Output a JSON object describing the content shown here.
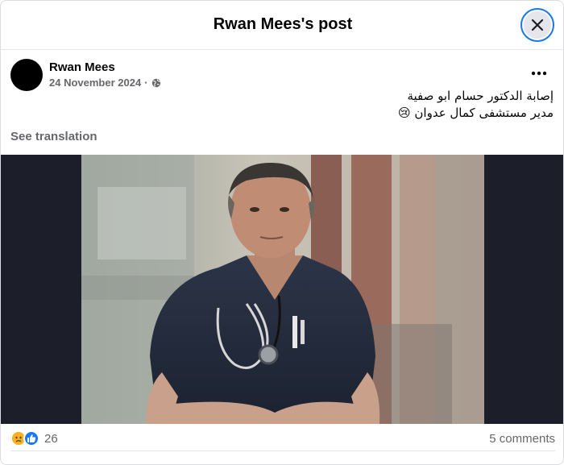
{
  "dialog": {
    "title": "Rwan Mees's post",
    "close_icon": "close-icon"
  },
  "post": {
    "author": "Rwan Mees",
    "date": "24 November 2024",
    "separator": "·",
    "privacy_icon": "globe-icon",
    "more_icon": "more-horizontal-icon",
    "text_line1": "إصابة الدكتور حسام ابو صفية",
    "text_line2": "مدير مستشفى كمال عدوان 😢",
    "see_translation": "See translation"
  },
  "footer": {
    "reaction_icons": [
      "sad-reaction-icon",
      "like-reaction-icon"
    ],
    "reaction_count": "26",
    "comments": "5 comments"
  },
  "colors": {
    "primary_text": "#050505",
    "secondary_text": "#65676b",
    "accent": "#1877f2",
    "media_bg": "#1c1e2a"
  }
}
